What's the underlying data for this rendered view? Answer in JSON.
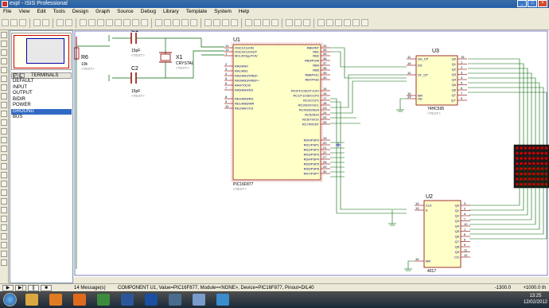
{
  "window": {
    "title": "expl - ISIS Professional"
  },
  "menu": [
    "File",
    "View",
    "Edit",
    "Tools",
    "Design",
    "Graph",
    "Source",
    "Debug",
    "Library",
    "Template",
    "System",
    "Help"
  ],
  "panel": {
    "mode_buttons": [
      "P",
      "L"
    ],
    "title": "TERMINALS",
    "items": [
      "DEFAULT",
      "INPUT",
      "OUTPUT",
      "BIDIR",
      "POWER",
      "GROUND",
      "BUS"
    ],
    "selected": "GROUND"
  },
  "schematic": {
    "r6": {
      "ref": "R6",
      "value": "10k",
      "text": "<TEXT>"
    },
    "c1": {
      "ref": "C1",
      "value": "15pF",
      "text": "<TEXT>"
    },
    "c2": {
      "ref": "C2",
      "value": "15pF",
      "text": "<TEXT>"
    },
    "x1": {
      "ref": "X1",
      "value": "CRYSTAL",
      "text": "<TEXT>"
    },
    "u1": {
      "ref": "U1",
      "part": "PIC16F877",
      "text": "<TEXT>",
      "left_pins": [
        {
          "n": "13",
          "name": "OSC1/CLKIN"
        },
        {
          "n": "14",
          "name": "OSC2/CLKOUT"
        },
        {
          "n": "1",
          "name": "MCLR/Vpp/THV"
        },
        {
          "n": "2",
          "name": "RA0/AN0"
        },
        {
          "n": "3",
          "name": "RA1/AN1"
        },
        {
          "n": "4",
          "name": "RA2/AN2/VREF-"
        },
        {
          "n": "5",
          "name": "RA3/AN3/VREF+"
        },
        {
          "n": "6",
          "name": "RA4/T0CKI"
        },
        {
          "n": "7",
          "name": "RA5/AN4/SS"
        },
        {
          "n": "8",
          "name": "RE0/AN5/RD"
        },
        {
          "n": "9",
          "name": "RE1/AN6/WR"
        },
        {
          "n": "10",
          "name": "RE2/AN7/CS"
        }
      ],
      "right_pins": [
        {
          "n": "33",
          "name": "RB0/INT"
        },
        {
          "n": "34",
          "name": "RB1"
        },
        {
          "n": "35",
          "name": "RB2"
        },
        {
          "n": "36",
          "name": "RB3/PGM"
        },
        {
          "n": "37",
          "name": "RB4"
        },
        {
          "n": "38",
          "name": "RB5"
        },
        {
          "n": "39",
          "name": "RB6/PGC"
        },
        {
          "n": "40",
          "name": "RB7/PGD"
        },
        {
          "n": "15",
          "name": "RC0/T1OSO/T1CKI"
        },
        {
          "n": "16",
          "name": "RC1/T1OSI/CCP2"
        },
        {
          "n": "17",
          "name": "RC2/CCP1"
        },
        {
          "n": "18",
          "name": "RC3/SCK/SCL"
        },
        {
          "n": "23",
          "name": "RC4/SDI/SDA"
        },
        {
          "n": "24",
          "name": "RC5/SDO"
        },
        {
          "n": "25",
          "name": "RC6/TX/CK"
        },
        {
          "n": "26",
          "name": "RC7/RX/DT"
        },
        {
          "n": "19",
          "name": "RD0/PSP0"
        },
        {
          "n": "20",
          "name": "RD1/PSP1"
        },
        {
          "n": "21",
          "name": "RD2/PSP2"
        },
        {
          "n": "22",
          "name": "RD3/PSP3"
        },
        {
          "n": "27",
          "name": "RD4/PSP4"
        },
        {
          "n": "28",
          "name": "RD5/PSP5"
        },
        {
          "n": "29",
          "name": "RD6/PSP6"
        },
        {
          "n": "30",
          "name": "RD7/PSP7"
        }
      ]
    },
    "u3": {
      "ref": "U3",
      "part": "74HC595",
      "text": "<TEXT>",
      "left_pins": [
        {
          "n": "11",
          "name": "SH_CP"
        },
        {
          "n": "14",
          "name": "DS"
        },
        {
          "n": "12",
          "name": "ST_CP"
        },
        {
          "n": "10",
          "name": "MR"
        },
        {
          "n": "13",
          "name": "OE"
        }
      ],
      "right_pins": [
        {
          "n": "15",
          "name": "Q0"
        },
        {
          "n": "1",
          "name": "Q1"
        },
        {
          "n": "2",
          "name": "Q2"
        },
        {
          "n": "3",
          "name": "Q3"
        },
        {
          "n": "4",
          "name": "Q4"
        },
        {
          "n": "5",
          "name": "Q5"
        },
        {
          "n": "6",
          "name": "Q6"
        },
        {
          "n": "7",
          "name": "Q7"
        },
        {
          "n": "9",
          "name": "Q7'"
        }
      ]
    },
    "u2": {
      "ref": "U2",
      "part": "4017",
      "text": "<TEXT>",
      "left_pins": [
        {
          "n": "14",
          "name": "CLK"
        },
        {
          "n": "13",
          "name": "E"
        },
        {
          "n": "15",
          "name": "MR"
        }
      ],
      "right_pins": [
        {
          "n": "3",
          "name": "Q0"
        },
        {
          "n": "2",
          "name": "Q1"
        },
        {
          "n": "4",
          "name": "Q2"
        },
        {
          "n": "7",
          "name": "Q3"
        },
        {
          "n": "10",
          "name": "Q4"
        },
        {
          "n": "1",
          "name": "Q5"
        },
        {
          "n": "5",
          "name": "Q6"
        },
        {
          "n": "6",
          "name": "Q7"
        },
        {
          "n": "9",
          "name": "Q8"
        },
        {
          "n": "11",
          "name": "Q9"
        },
        {
          "n": "12",
          "name": "CO"
        }
      ]
    },
    "led_matrix": {
      "rows": 8,
      "cols": 8,
      "color": "#cc0000"
    }
  },
  "status": {
    "messages": "14 Message(s)",
    "info": "COMPONENT U1, Value=PIC16F877, Module=<NONE>, Device=PIC16F877, Pinout=DIL40",
    "coord_x": "-1300.0",
    "coord_y": "+1000.0",
    "unit": "th"
  },
  "taskbar": {
    "time": "13:25",
    "date": "12/02/2012",
    "apps": [
      "explorer-icon",
      "media-player-icon",
      "firefox-icon",
      "chrome-icon",
      "word-icon",
      "isis-icon",
      "monitor-icon",
      "paint-icon",
      "3dsmax-icon"
    ]
  },
  "colors": {
    "wire": "#006400",
    "component_body": "#ffffc8",
    "component_border": "#8b0000",
    "pin_text": "#000080"
  }
}
